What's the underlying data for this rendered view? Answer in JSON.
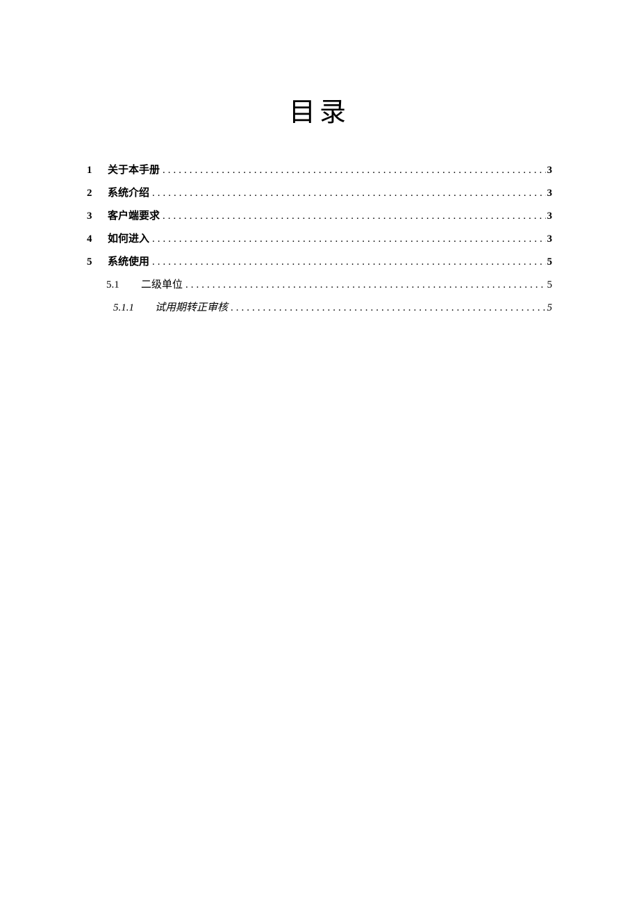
{
  "title": "目录",
  "toc": {
    "e1": {
      "num": "1",
      "label": "关于本手册",
      "page": "3"
    },
    "e2": {
      "num": "2",
      "label": "系统介绍",
      "page": "3"
    },
    "e3": {
      "num": "3",
      "label": "客户端要求",
      "page": "3"
    },
    "e4": {
      "num": "4",
      "label": "如何进入",
      "page": "3"
    },
    "e5": {
      "num": "5",
      "label": "系统使用",
      "page": "5"
    },
    "e5_1": {
      "num": "5.1",
      "label": "二级单位",
      "page": "5"
    },
    "e5_1_1": {
      "num": "5.1.1",
      "label": "试用期转正审核",
      "page": "5"
    }
  }
}
